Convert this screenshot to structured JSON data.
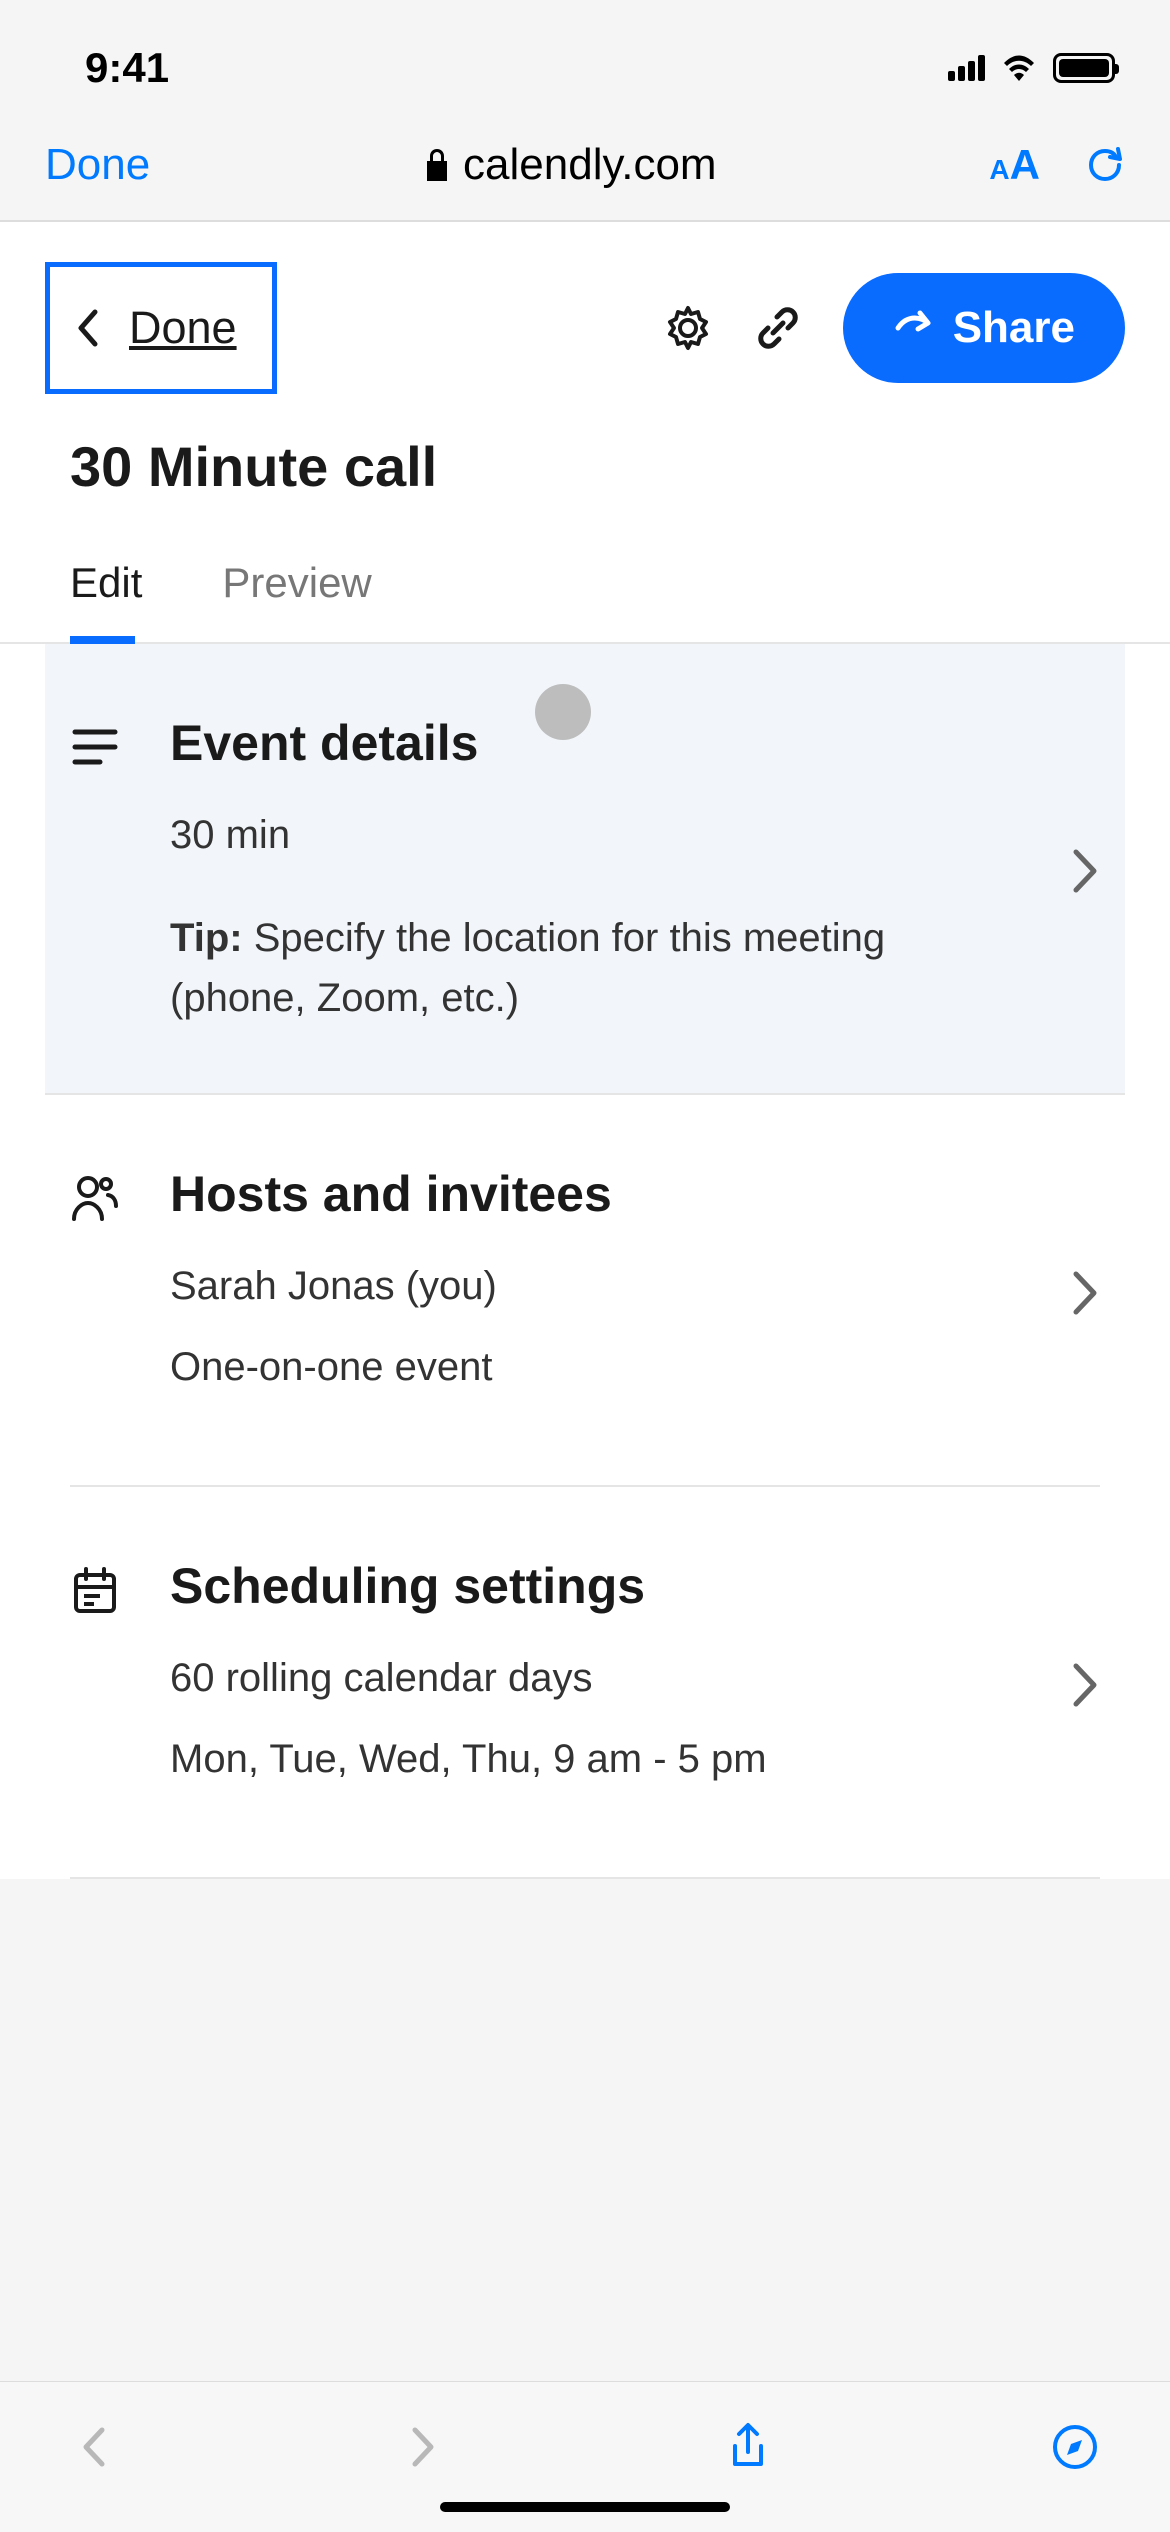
{
  "statusBar": {
    "time": "9:41"
  },
  "safari": {
    "doneLabel": "Done",
    "url": "calendly.com"
  },
  "appBar": {
    "doneLabel": "Done",
    "shareLabel": "Share"
  },
  "pageTitle": "30 Minute call",
  "tabs": {
    "edit": "Edit",
    "preview": "Preview"
  },
  "sections": {
    "eventDetails": {
      "title": "Event details",
      "duration": "30 min",
      "tipPrefix": "Tip:",
      "tipText": " Specify the location for this meeting (phone, Zoom, etc.)"
    },
    "hosts": {
      "title": "Hosts and invitees",
      "host": "Sarah Jonas (you)",
      "eventType": "One-on-one event"
    },
    "scheduling": {
      "title": "Scheduling settings",
      "range": "60 rolling calendar days",
      "availability": "Mon, Tue, Wed, Thu, 9 am - 5 pm"
    }
  }
}
